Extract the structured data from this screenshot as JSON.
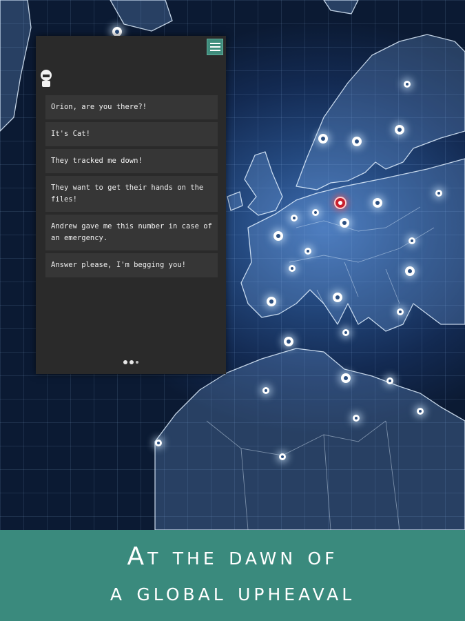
{
  "chat": {
    "menu_icon": "hamburger-icon",
    "avatar_icon": "contact-avatar",
    "messages": [
      "Orion, are you there?!",
      "It's Cat!",
      "They tracked me down!",
      "They want to get their hands on the files!",
      "Andrew gave me this number in case of an emergency.",
      "Answer please, I'm begging you!"
    ],
    "page_count": 3,
    "current_page": 2
  },
  "footer": {
    "line1": "At the dawn of",
    "line2": "a global upheaval"
  },
  "colors": {
    "accent": "#3a8a7d",
    "panel": "#2a2a2a",
    "marker_alert": "#c8202d"
  }
}
